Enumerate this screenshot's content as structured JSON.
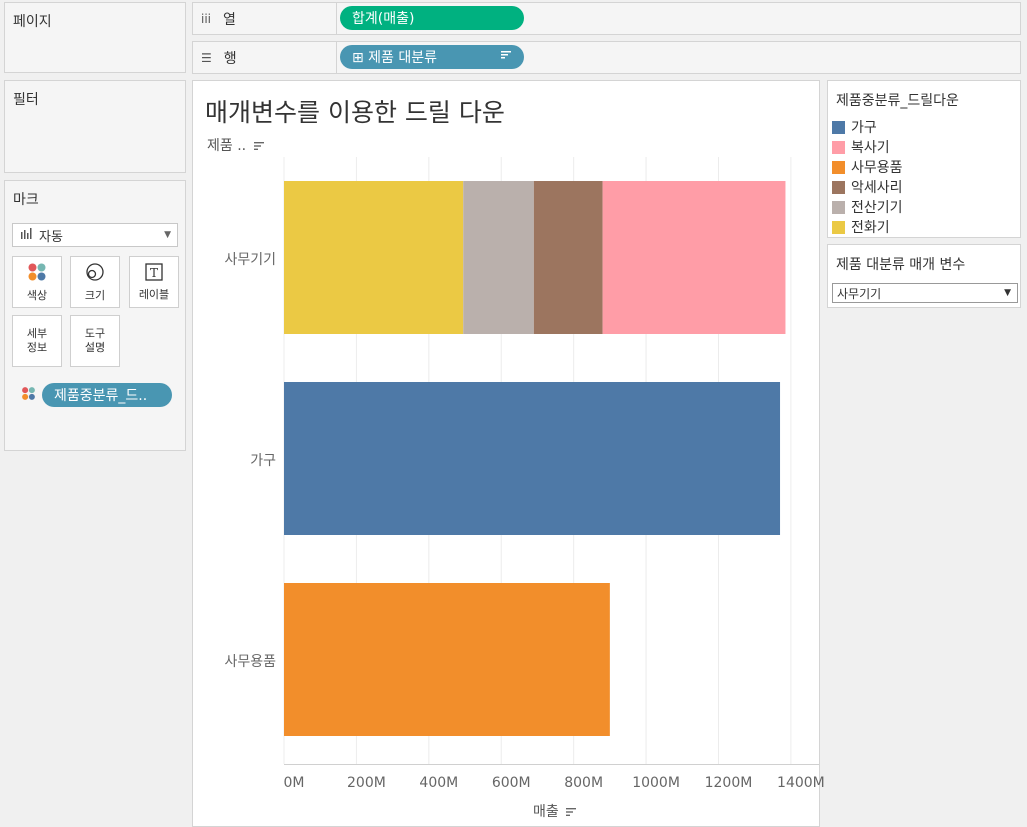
{
  "left_panels": {
    "pages_title": "페이지",
    "filters_title": "필터",
    "marks_title": "마크"
  },
  "shelves": {
    "columns": {
      "icon": "iii",
      "label": "열",
      "pill": "합계(매출)",
      "pill_color": "#00b180"
    },
    "rows": {
      "icon": "☰",
      "label": "행",
      "pill": "⊞ 제품 대분류",
      "pill_color": "#4996b2"
    }
  },
  "marks": {
    "type": "자동",
    "cards": [
      {
        "id": "color",
        "label": "색상"
      },
      {
        "id": "size",
        "label": "크기"
      },
      {
        "id": "label",
        "label": "레이블"
      },
      {
        "id": "detail",
        "label": "세부\n정보"
      },
      {
        "id": "tooltip",
        "label": "도구\n설명"
      }
    ],
    "color_pill": "제품중분류_드..",
    "color_pill_color": "#4996b2"
  },
  "chart_data": {
    "type": "bar",
    "orientation": "horizontal",
    "stacked": true,
    "title": "매개변수를 이용한 드릴 다운",
    "y_header": "제품 ..",
    "xlabel": "매출",
    "xlim": [
      0,
      1450
    ],
    "x_unit": "M",
    "x_ticks": [
      "0M",
      "200M",
      "400M",
      "600M",
      "800M",
      "1000M",
      "1200M",
      "1400M"
    ],
    "x_tick_values": [
      0,
      200,
      400,
      600,
      800,
      1000,
      1200,
      1400
    ],
    "grid": true,
    "categories": [
      "사무기기",
      "가구",
      "사무용품"
    ],
    "series": [
      {
        "name": "전화기",
        "color": "#ebc944",
        "values": [
          495,
          0,
          0
        ]
      },
      {
        "name": "전산기기",
        "color": "#bab0ac",
        "values": [
          195,
          0,
          0
        ]
      },
      {
        "name": "악세사리",
        "color": "#9c755f",
        "values": [
          190,
          0,
          0
        ]
      },
      {
        "name": "복사기",
        "color": "#ff9da7",
        "values": [
          505,
          0,
          0
        ]
      },
      {
        "name": "가구",
        "color": "#4e79a7",
        "values": [
          0,
          1370,
          0
        ]
      },
      {
        "name": "사무용품",
        "color": "#f28e2b",
        "values": [
          0,
          0,
          900
        ]
      }
    ]
  },
  "legend": {
    "title": "제품중분류_드릴다운",
    "items": [
      {
        "label": "가구",
        "color": "#4e79a7"
      },
      {
        "label": "복사기",
        "color": "#ff9da7"
      },
      {
        "label": "사무용품",
        "color": "#f28e2b"
      },
      {
        "label": "악세사리",
        "color": "#9c755f"
      },
      {
        "label": "전산기기",
        "color": "#bab0ac"
      },
      {
        "label": "전화기",
        "color": "#ebc944"
      }
    ]
  },
  "parameter": {
    "title": "제품 대분류 매개 변수",
    "value": "사무기기"
  }
}
